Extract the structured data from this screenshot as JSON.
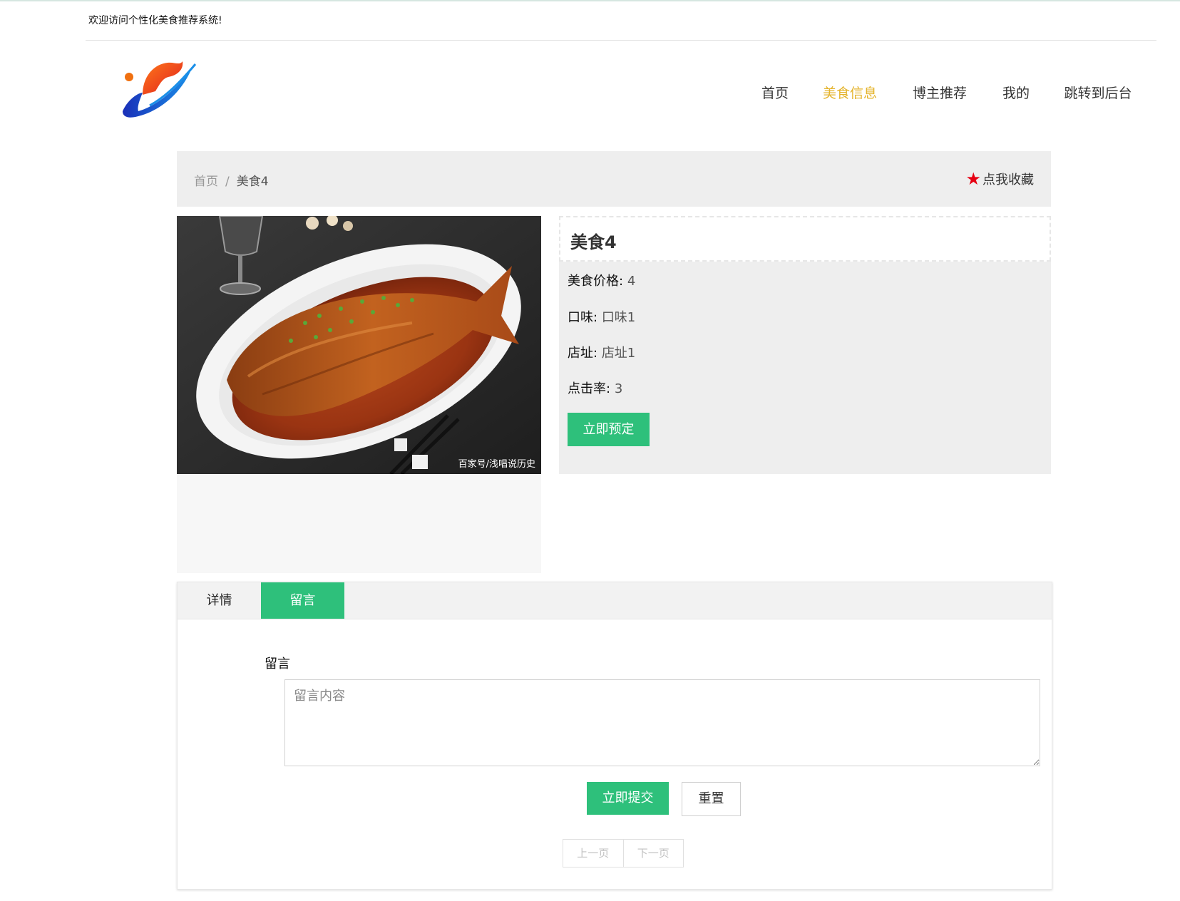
{
  "header": {
    "welcome": "欢迎访问个性化美食推荐系统!"
  },
  "nav": {
    "items": [
      {
        "label": "首页"
      },
      {
        "label": "美食信息",
        "active": true
      },
      {
        "label": "博主推荐"
      },
      {
        "label": "我的"
      },
      {
        "label": "跳转到后台"
      }
    ],
    "active_color": "#e4b32a"
  },
  "breadcrumb": {
    "home": "首页",
    "separator": "/",
    "current": "美食4"
  },
  "favorite": {
    "icon": "star-icon",
    "label": "点我收藏"
  },
  "image": {
    "watermark": "百家号/浅唱说历史"
  },
  "detail": {
    "title": "美食4",
    "fields": [
      {
        "label": "美食价格:",
        "value": "4"
      },
      {
        "label": "口味:",
        "value": "口味1"
      },
      {
        "label": "店址:",
        "value": "店址1"
      },
      {
        "label": "点击率:",
        "value": "3"
      }
    ],
    "book_button": "立即预定"
  },
  "tabs": [
    {
      "label": "详情"
    },
    {
      "label": "留言",
      "active": true
    }
  ],
  "comment": {
    "label": "留言",
    "placeholder": "留言内容",
    "submit": "立即提交",
    "reset": "重置"
  },
  "pager": {
    "prev": "上一页",
    "next": "下一页"
  },
  "colors": {
    "accent_green": "#2ec07b",
    "favorite_star": "#e60012"
  }
}
